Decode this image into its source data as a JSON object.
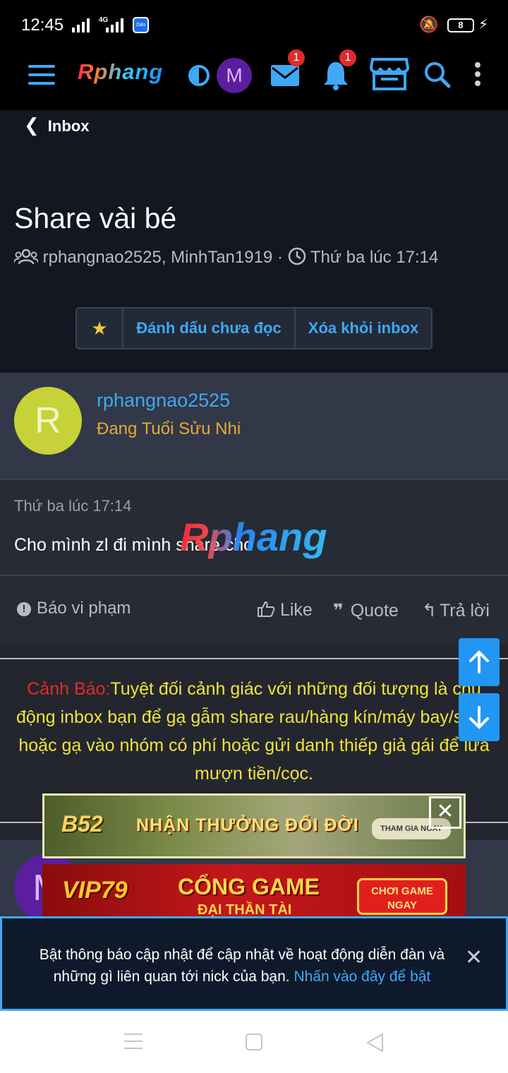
{
  "status_bar": {
    "time": "12:45",
    "network": "4G",
    "zalo": "Zalo",
    "battery": "8"
  },
  "header": {
    "logo": "Rphang",
    "avatar_letter": "M",
    "inbox_badge": "1",
    "alerts_badge": "1"
  },
  "breadcrumb": {
    "back_label": "Inbox"
  },
  "thread": {
    "title": "Share vài bé",
    "participants": "rphangnao2525, MinhTan1919",
    "separator": "·",
    "time": "Thứ ba lúc 17:14"
  },
  "actions": {
    "mark_unread": "Đánh dấu chưa đọc",
    "delete": "Xóa khỏi inbox"
  },
  "message": {
    "avatar_letter": "R",
    "username": "rphangnao2525",
    "user_title": "Đang Tuổi Sửu Nhi",
    "time": "Thứ ba lúc 17:14",
    "text": "Cho mình zl đi mình share cho",
    "watermark": "Rphang",
    "report": "Báo vi phạm",
    "like": "Like",
    "quote": "Quote",
    "reply": "Trả lời"
  },
  "warning": {
    "label": "Cảnh Báo:",
    "text": "Tuyệt đối cảnh giác với những đối tượng là chủ động inbox bạn để gạ gẫm share rau/hàng kín/máy bay/sgbb hoặc gạ vào nhóm có phí hoặc gửi danh thiếp giả gái để lừa mượn tiền/cọc."
  },
  "post2": {
    "avatar_letter": "M"
  },
  "ads": {
    "ad1_logo": "B52",
    "ad1_text": "NHẬN THƯỞNG ĐỔI ĐỜI",
    "ad1_cta": "THAM GIA NGAY",
    "ad2_logo": "VIP79",
    "ad2_text": "CỔNG GAME",
    "ad2_sub": "ĐẠI THẦN TÀI",
    "ad2_cta": "CHƠI GAME NGAY",
    "close": "✕"
  },
  "notification": {
    "text": "Bật thông báo cập nhật để cập nhật về hoạt động diễn đàn và những gì liên quan tới nick của bạn.",
    "link": "Nhấn vào đây để bật",
    "close": "✕"
  },
  "colors": {
    "accent": "#3fa9f5",
    "header_bg": "#000000",
    "card_bg": "#323847",
    "warning_text": "#f1e33a",
    "warning_label": "#e02b2b",
    "badge": "#e02b2b"
  }
}
